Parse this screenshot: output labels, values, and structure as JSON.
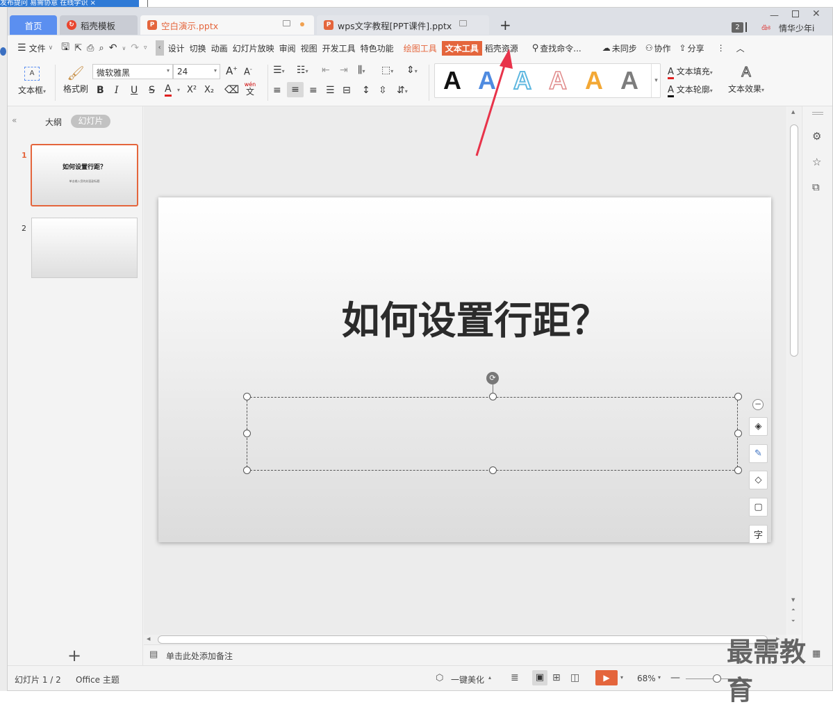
{
  "background": {
    "top_left_text": "发布提问  易需协意 在线学识 ×",
    "top_right_text": "|"
  },
  "tabs": [
    {
      "label": "首页"
    },
    {
      "label": "稻壳模板"
    },
    {
      "label": "空白演示.pptx"
    },
    {
      "label": "wps文字教程[PPT课件].pptx"
    }
  ],
  "tabbar": {
    "new_tab": "+",
    "badge": "2",
    "user": "情华少年i"
  },
  "menu": {
    "file": "文件",
    "items": [
      "设计",
      "切换",
      "动画",
      "幻灯片放映",
      "审阅",
      "视图",
      "开发工具",
      "特色功能"
    ],
    "drawing_tools": "绘图工具",
    "text_tools": "文本工具",
    "resources": "稻壳资源",
    "search": "查找命令...",
    "sync": "未同步",
    "collab": "协作",
    "share": "分享"
  },
  "ribbon": {
    "textbox": "文本框",
    "format_painter": "格式刷",
    "font_name": "微软雅黑",
    "font_size": "24",
    "text_fill": "文本填充",
    "text_outline": "文本轮廓",
    "text_effect": "文本效果",
    "style_letter": "A",
    "bold": "B",
    "italic": "I",
    "underline": "U",
    "strike": "S",
    "color_a": "A",
    "super": "X²",
    "sub": "X₂",
    "pinyin": "wén"
  },
  "left_pane": {
    "outline": "大纲",
    "slides": "幻灯片",
    "thumbs": [
      {
        "num": "1",
        "title": "如何设置行距？",
        "subtitle": "单击输入您的封面副标题"
      },
      {
        "num": "2"
      }
    ],
    "add": "+"
  },
  "slide": {
    "title": "如何设置行距？"
  },
  "notes": {
    "placeholder": "单击此处添加备注"
  },
  "status": {
    "slide_count": "幻灯片 1 / 2",
    "theme": "Office 主题",
    "beautify": "一键美化",
    "zoom": "68%"
  },
  "watermark": "最需教育",
  "colors": {
    "accent": "#e4653c",
    "tab_home": "#5b8ff0",
    "text_tools_bg": "#e4653c",
    "arrow": "#e8334a"
  }
}
